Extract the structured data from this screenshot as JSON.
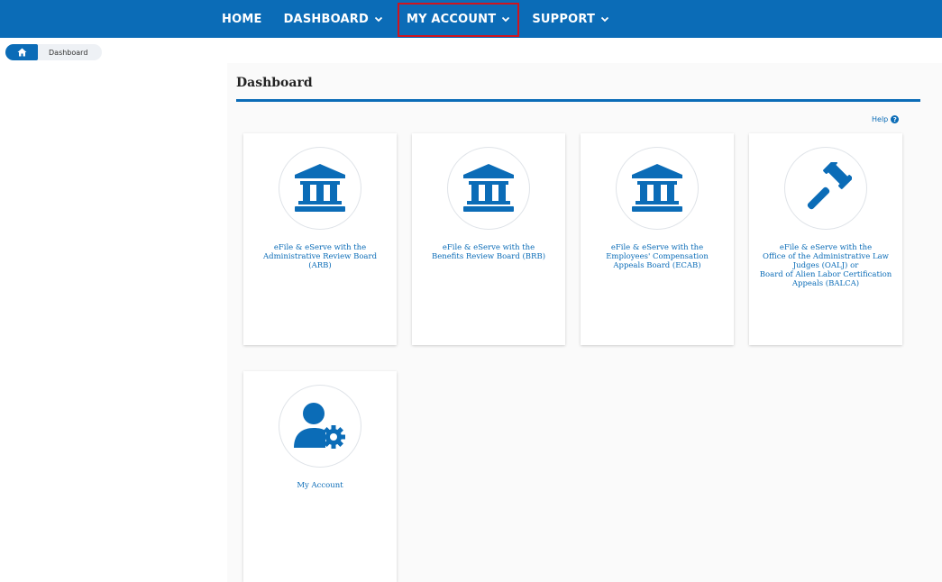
{
  "nav": {
    "items": [
      {
        "label": "HOME",
        "has_dropdown": false
      },
      {
        "label": "DASHBOARD",
        "has_dropdown": true
      },
      {
        "label": "MY ACCOUNT",
        "has_dropdown": true,
        "highlighted": true
      },
      {
        "label": "SUPPORT",
        "has_dropdown": true
      }
    ],
    "color": "#0b6cb7",
    "highlight_color": "#d0141e"
  },
  "breadcrumb": {
    "home_icon": "home-icon",
    "current": "Dashboard"
  },
  "page": {
    "title": "Dashboard",
    "help_label": "Help",
    "help_icon": "question-circle-icon"
  },
  "cards": [
    {
      "icon": "courthouse-icon",
      "lines": [
        "eFile & eServe with the",
        "Administrative Review Board",
        "(ARB)"
      ]
    },
    {
      "icon": "courthouse-icon",
      "lines": [
        "eFile & eServe with the",
        "Benefits Review Board (BRB)"
      ]
    },
    {
      "icon": "courthouse-icon",
      "lines": [
        "eFile & eServe with the",
        "Employees' Compensation",
        "Appeals Board (ECAB)"
      ]
    },
    {
      "icon": "gavel-icon",
      "lines": [
        "eFile & eServe with the",
        "Office of the Administrative Law",
        "Judges (OALJ) or",
        "Board of Alien Labor Certification",
        "Appeals (BALCA)"
      ]
    },
    {
      "icon": "user-gear-icon",
      "lines": [
        "My Account"
      ]
    }
  ]
}
